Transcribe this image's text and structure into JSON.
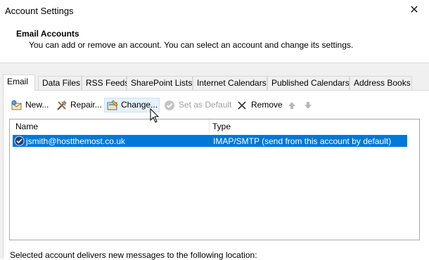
{
  "window": {
    "title": "Account Settings",
    "close_glyph": "✕"
  },
  "header": {
    "heading": "Email Accounts",
    "description": "You can add or remove an account. You can select an account and change its settings."
  },
  "tabs": [
    {
      "label": "Email",
      "active": true
    },
    {
      "label": "Data Files"
    },
    {
      "label": "RSS Feeds"
    },
    {
      "label": "SharePoint Lists"
    },
    {
      "label": "Internet Calendars"
    },
    {
      "label": "Published Calendars"
    },
    {
      "label": "Address Books"
    }
  ],
  "toolbar": {
    "new_label": "New...",
    "repair_label": "Repair...",
    "change_label": "Change...",
    "set_default_label": "Set as Default",
    "remove_label": "Remove"
  },
  "list": {
    "columns": [
      "Name",
      "Type"
    ],
    "rows": [
      {
        "name": "jsmith@hostthemost.co.uk",
        "type": "IMAP/SMTP (send from this account by default)",
        "selected": true
      }
    ]
  },
  "footer": {
    "text": "Selected account delivers new messages to the following location:"
  },
  "colors": {
    "selection": "#0078d7",
    "hover": "#e5f1fb",
    "background": "#f0f0f0"
  }
}
